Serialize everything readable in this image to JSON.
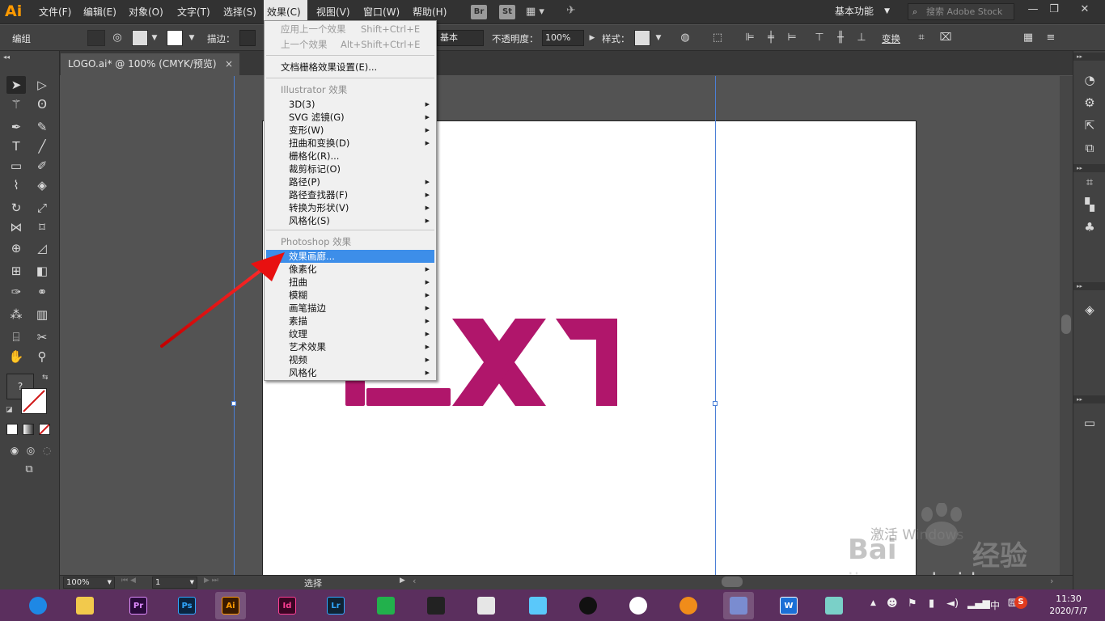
{
  "app": {
    "logo": "Ai",
    "menus": [
      "文件(F)",
      "编辑(E)",
      "对象(O)",
      "文字(T)",
      "选择(S)",
      "效果(C)",
      "视图(V)",
      "窗口(W)",
      "帮助(H)"
    ],
    "active_menu": "效果(C)",
    "bridge_icon": "Br",
    "stock_icon": "St",
    "workspace": "基本功能",
    "search_placeholder": "搜索 Adobe Stock"
  },
  "control_bar": {
    "mode_label": "编组",
    "stroke_label": "描边：",
    "stroke_style": "基本",
    "opacity_label": "不透明度：",
    "opacity_value": "100%",
    "style_label": "样式：",
    "transform_label": "变换"
  },
  "document": {
    "tab_title": "LOGO.ai* @ 100% (CMYK/预览)",
    "close_glyph": "×",
    "zoom": "100%",
    "artboard_number": "1",
    "status_text": "选择"
  },
  "effect_menu": {
    "items_top": [
      {
        "label": "应用上一个效果",
        "shortcut": "Shift+Ctrl+E",
        "disabled": true
      },
      {
        "label": "上一个效果",
        "shortcut": "Alt+Shift+Ctrl+E",
        "disabled": true
      }
    ],
    "raster_settings": "文档栅格效果设置(E)...",
    "illustrator_section": "Illustrator 效果",
    "illustrator_items": [
      {
        "label": "3D(3)",
        "submenu": true
      },
      {
        "label": "SVG 滤镜(G)",
        "submenu": true
      },
      {
        "label": "变形(W)",
        "submenu": true
      },
      {
        "label": "扭曲和变换(D)",
        "submenu": true
      },
      {
        "label": "栅格化(R)...",
        "submenu": false
      },
      {
        "label": "裁剪标记(O)",
        "submenu": false
      },
      {
        "label": "路径(P)",
        "submenu": true
      },
      {
        "label": "路径查找器(F)",
        "submenu": true
      },
      {
        "label": "转换为形状(V)",
        "submenu": true
      },
      {
        "label": "风格化(S)",
        "submenu": true
      }
    ],
    "photoshop_section": "Photoshop 效果",
    "photoshop_items": [
      {
        "label": "效果画廊...",
        "submenu": false,
        "highlighted": true
      },
      {
        "label": "像素化",
        "submenu": true
      },
      {
        "label": "扭曲",
        "submenu": true
      },
      {
        "label": "模糊",
        "submenu": true
      },
      {
        "label": "画笔描边",
        "submenu": true
      },
      {
        "label": "素描",
        "submenu": true
      },
      {
        "label": "纹理",
        "submenu": true
      },
      {
        "label": "艺术效果",
        "submenu": true
      },
      {
        "label": "视频",
        "submenu": true
      },
      {
        "label": "风格化",
        "submenu": true
      }
    ]
  },
  "artwork": {
    "logo_color": "#b0166b"
  },
  "watermark": {
    "activate_text": "激活 Windows",
    "baidu_text": "Bai",
    "jingyan_text": "经验",
    "url": "jingyan.baidu.com"
  },
  "taskbar": {
    "apps": [
      {
        "name": "browser-360",
        "label": "",
        "color": "#1e88e5"
      },
      {
        "name": "file-explorer",
        "label": "",
        "color": "#f2c94c"
      },
      {
        "name": "premiere",
        "label": "Pr",
        "color": "#2a0a3b"
      },
      {
        "name": "photoshop",
        "label": "Ps",
        "color": "#0a2540"
      },
      {
        "name": "illustrator",
        "label": "Ai",
        "color": "#3a1a00"
      },
      {
        "name": "indesign",
        "label": "Id",
        "color": "#3a0524"
      },
      {
        "name": "lightroom",
        "label": "Lr",
        "color": "#0f2333"
      },
      {
        "name": "recycle-app",
        "label": "",
        "color": "#22b14c"
      },
      {
        "name": "video-editor",
        "label": "",
        "color": "#222222"
      },
      {
        "name": "umbrella-app",
        "label": "",
        "color": "#e6e6e6"
      },
      {
        "name": "cat-app",
        "label": "",
        "color": "#5ac8fa"
      },
      {
        "name": "qq",
        "label": "",
        "color": "#111111"
      },
      {
        "name": "chrome",
        "label": "",
        "color": "#ffffff"
      },
      {
        "name": "firefox-like",
        "label": "",
        "color": "#f08c1a"
      },
      {
        "name": "notepad-app",
        "label": "",
        "color": "#7a8cd0"
      },
      {
        "name": "wps",
        "label": "W",
        "color": "#1b6fd6"
      },
      {
        "name": "notes-app",
        "label": "",
        "color": "#7ad0c8"
      }
    ],
    "time": "11:30",
    "date": "2020/7/7",
    "ime_label": "中"
  }
}
